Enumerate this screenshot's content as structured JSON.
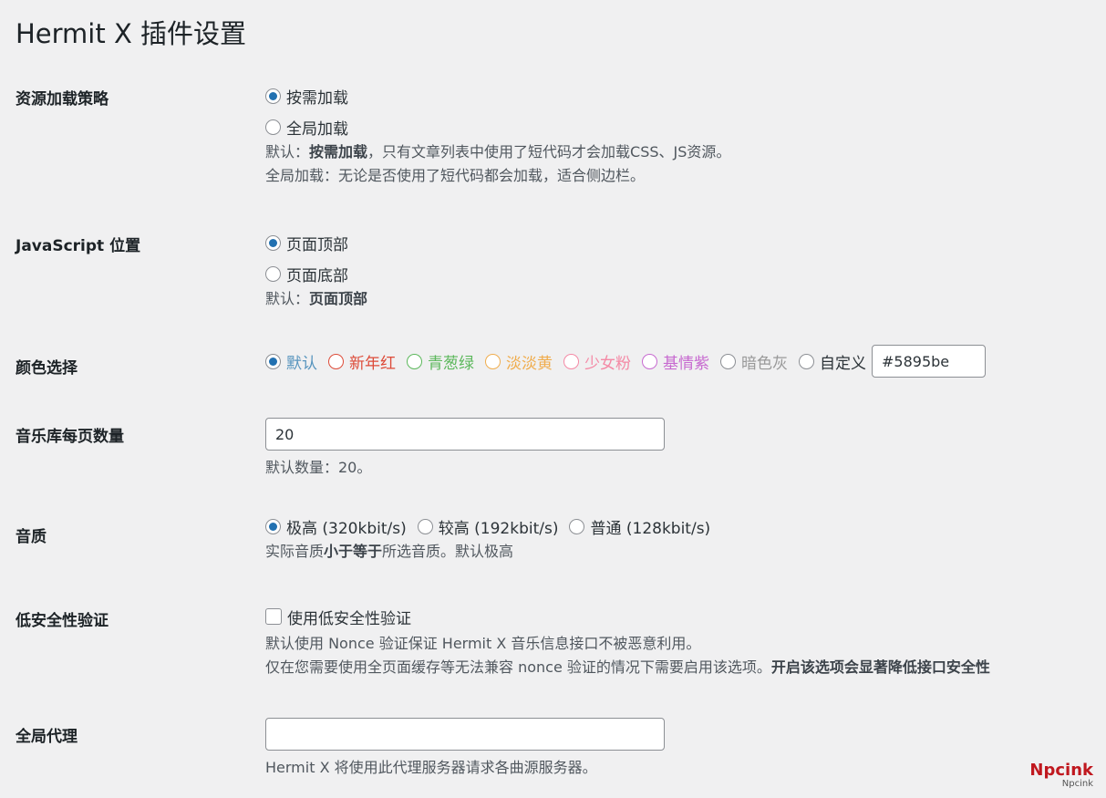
{
  "page_title": "Hermit X 插件设置",
  "sections": {
    "resource": {
      "label": "资源加载策略",
      "options": [
        "按需加载",
        "全局加载"
      ],
      "selected": 0,
      "desc1_prefix": "默认：",
      "desc1_bold": "按需加载",
      "desc1_suffix": "，只有文章列表中使用了短代码才会加载CSS、JS资源。",
      "desc2": "全局加载：无论是否使用了短代码都会加载，适合侧边栏。"
    },
    "js_position": {
      "label": "JavaScript 位置",
      "options": [
        "页面顶部",
        "页面底部"
      ],
      "selected": 0,
      "desc_prefix": "默认：",
      "desc_bold": "页面顶部"
    },
    "color": {
      "label": "颜色选择",
      "options": [
        {
          "label": "默认",
          "color": "#5895be"
        },
        {
          "label": "新年红",
          "color": "#dd4b39"
        },
        {
          "label": "青葱绿",
          "color": "#5cb85c"
        },
        {
          "label": "淡淡黄",
          "color": "#f0ad4e"
        },
        {
          "label": "少女粉",
          "color": "#f489a5"
        },
        {
          "label": "基情紫",
          "color": "#c76ad0"
        },
        {
          "label": "暗色灰",
          "color": "#999999"
        },
        {
          "label": "自定义",
          "color": "#3c434a"
        }
      ],
      "selected": 0,
      "custom_value": "#5895be"
    },
    "music_per_page": {
      "label": "音乐库每页数量",
      "value": "20",
      "desc": "默认数量：20。"
    },
    "quality": {
      "label": "音质",
      "options": [
        "极高 (320kbit/s)",
        "较高 (192kbit/s)",
        "普通 (128kbit/s)"
      ],
      "selected": 0,
      "desc_prefix": "实际音质",
      "desc_bold": "小于等于",
      "desc_suffix": "所选音质。默认极高"
    },
    "low_security": {
      "label": "低安全性验证",
      "checkbox_label": "使用低安全性验证",
      "checked": false,
      "desc1": "默认使用 Nonce 验证保证 Hermit X 音乐信息接口不被恶意利用。",
      "desc2_prefix": "仅在您需要使用全页面缓存等无法兼容 nonce 验证的情况下需要启用该选项。",
      "desc2_bold": "开启该选项会显著降低接口安全性"
    },
    "proxy": {
      "label": "全局代理",
      "value": "",
      "desc": "Hermit X 将使用此代理服务器请求各曲源服务器。"
    }
  },
  "watermark": {
    "main": "Npcink",
    "sub": "Npcink"
  }
}
